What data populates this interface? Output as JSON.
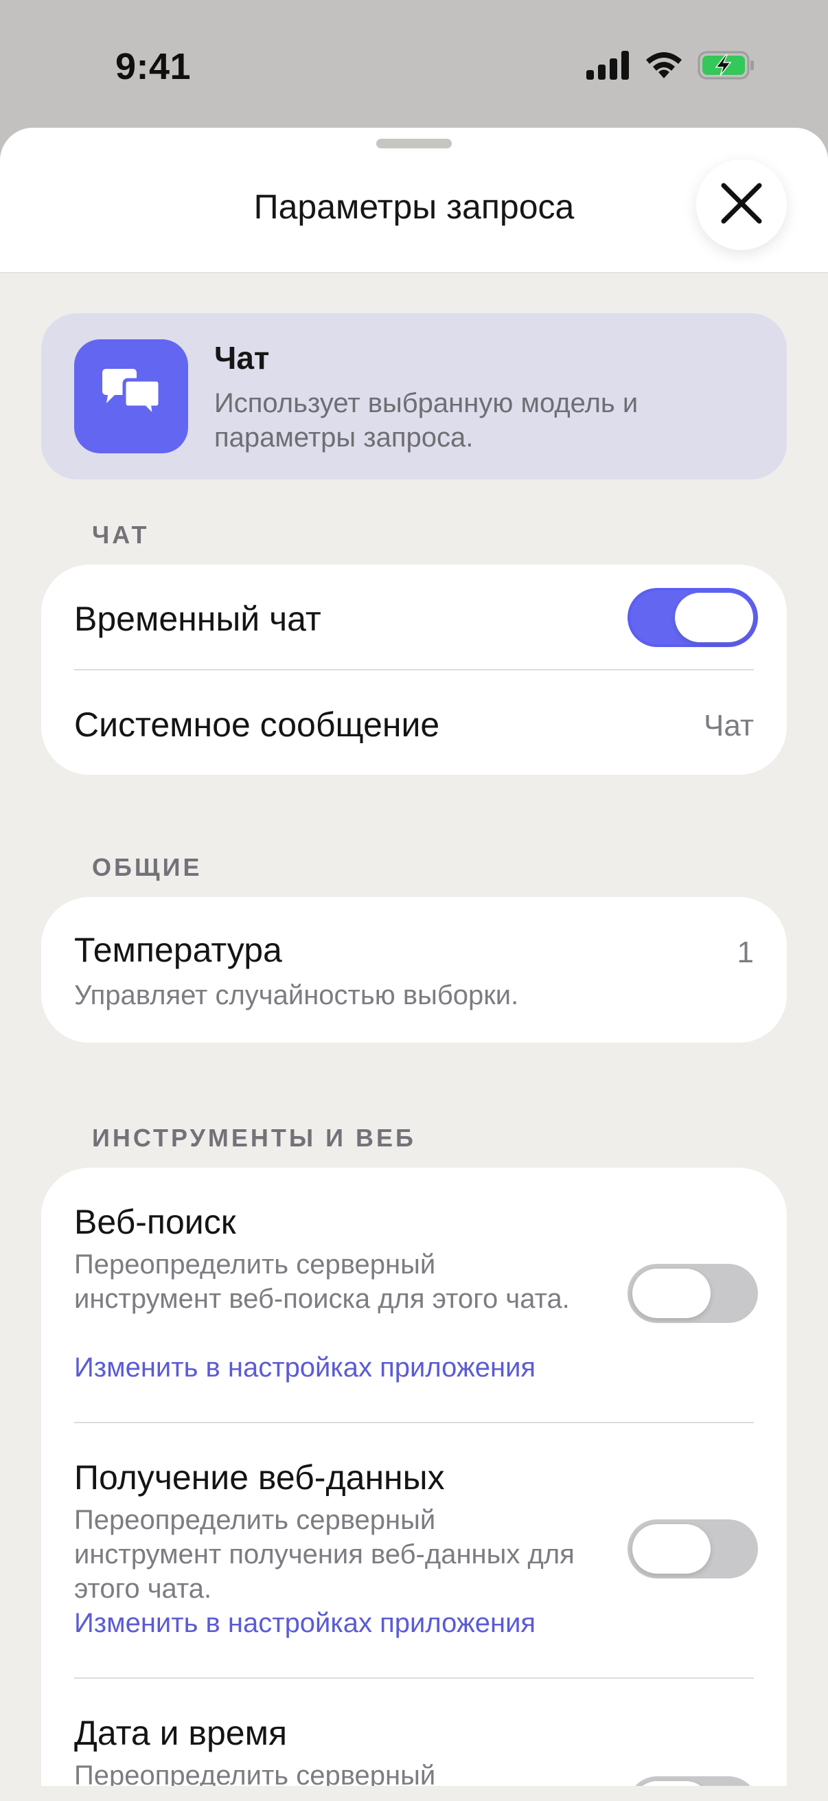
{
  "status_bar": {
    "time": "9:41",
    "icons": [
      "signal-icon",
      "wifi-icon",
      "battery-charging-icon"
    ]
  },
  "sheet": {
    "title": "Параметры запроса"
  },
  "mode": {
    "icon": "chat-bubbles-icon",
    "title": "Чат",
    "description": "Использует выбранную модель и параметры запроса."
  },
  "sections": {
    "chat": {
      "label": "ЧАТ",
      "temporary_chat": {
        "label": "Временный чат",
        "enabled": true
      },
      "system_message": {
        "label": "Системное сообщение",
        "value": "Чат"
      }
    },
    "general": {
      "label": "ОБЩИЕ",
      "temperature": {
        "label": "Температура",
        "value": "1",
        "description": "Управляет случайностью выборки."
      }
    },
    "tools": {
      "label": "ИНСТРУМЕНТЫ И ВЕБ",
      "web_search": {
        "label": "Веб-поиск",
        "description": "Переопределить серверный инструмент веб-поиска для этого чата.",
        "link": "Изменить в настройках приложения",
        "enabled": false
      },
      "web_fetch": {
        "label": "Получение веб-данных",
        "description": "Переопределить серверный инструмент получения веб-данных для этого чата.",
        "link": "Изменить в настройках приложения",
        "enabled": false
      },
      "date_time": {
        "label": "Дата и время",
        "description": "Переопределить серверный"
      }
    }
  },
  "colors": {
    "accent": "#6366f1",
    "link": "#5b5bd6",
    "sheet_background": "#efeeeb",
    "mode_card": "#deddec",
    "battery": "#34c759"
  }
}
